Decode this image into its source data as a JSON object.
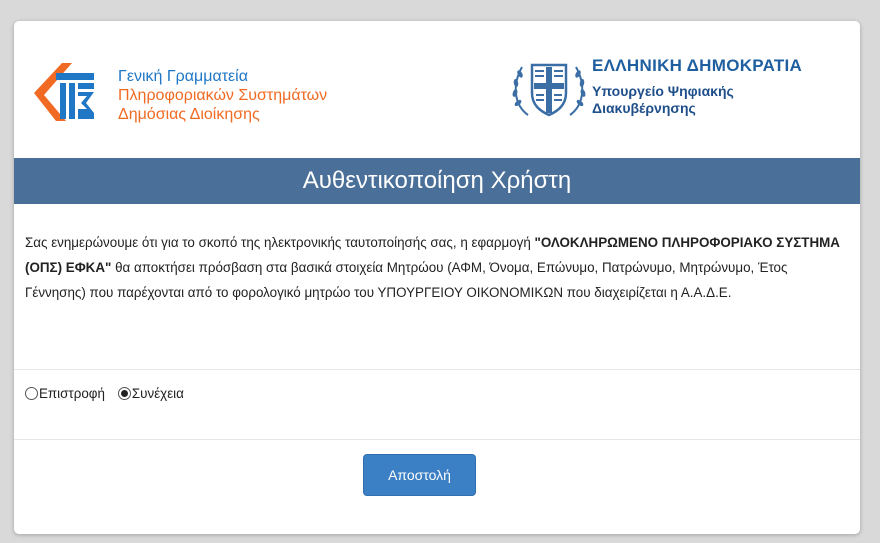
{
  "header": {
    "gsis": {
      "line1": "Γενική Γραμματεία",
      "line2": "Πληροφοριακών Συστημάτων",
      "line3": "Δημόσιας Διοίκησης"
    },
    "gov": {
      "country": "ΕΛΛΗΝΙΚΗ ΔΗΜΟΚΡΑΤΙΑ",
      "ministry_line1": "Υπουργείο Ψηφιακής",
      "ministry_line2": "Διακυβέρνησης"
    }
  },
  "title": "Αυθεντικοποίηση Χρήστη",
  "notice": {
    "part1": "Σας ενημερώνουμε ότι για το σκοπό της ηλεκτρονικής ταυτοποίησής σας, η εφαρμογή ",
    "app_name": "\"ΟΛΟΚΛΗΡΩΜΕΝΟ ΠΛΗΡΟΦΟΡΙΑΚΟ ΣΥΣΤΗΜΑ (ΟΠΣ) ΕΦΚΑ\"",
    "part2": " θα αποκτήσει πρόσβαση στα βασικά στοιχεία Μητρώου (ΑΦΜ, Όνομα, Επώνυμο, Πατρώνυμο, Μητρώνυμο, Έτος Γέννησης) που παρέχονται από το φορολογικό μητρώο του ΥΠΟΥΡΓΕΙΟΥ ΟΙΚΟΝΟΜΙΚΩΝ που διαχειρίζεται η Α.Α.Δ.Ε."
  },
  "options": [
    {
      "label": "Επιστροφή",
      "checked": false
    },
    {
      "label": "Συνέχεια",
      "checked": true
    }
  ],
  "submit_label": "Αποστολή",
  "colors": {
    "title_bar": "#4a6f98",
    "button": "#3b7fc4",
    "gsis_blue": "#1f77c6",
    "gsis_orange": "#f06a23",
    "gov_blue": "#1f5fa0"
  }
}
